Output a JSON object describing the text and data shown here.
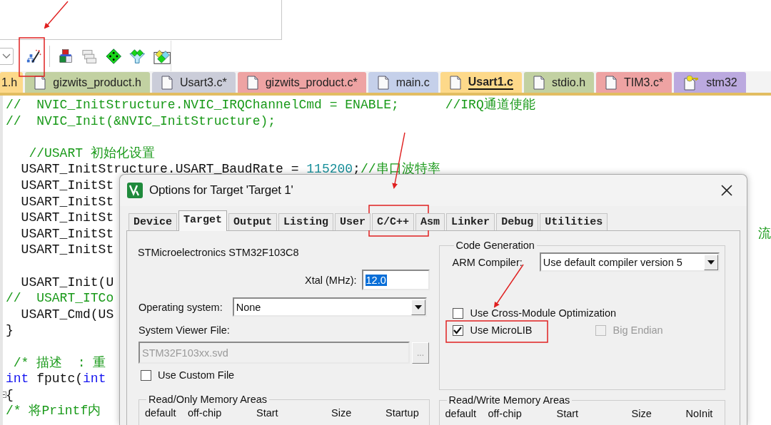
{
  "file_tabs": [
    {
      "label": "1.h",
      "kind": "cut",
      "color": "#fdd98a",
      "selected": false
    },
    {
      "label": "gizwits_product.h",
      "kind": "file",
      "color": "#c2d1a2",
      "selected": false
    },
    {
      "label": "Usart3.c*",
      "kind": "file",
      "color": "#cbcdd9",
      "selected": false
    },
    {
      "label": "gizwits_product.c*",
      "kind": "file",
      "color": "#eea3a3",
      "selected": false
    },
    {
      "label": "main.c",
      "kind": "file",
      "color": "#c5d0ea",
      "selected": false
    },
    {
      "label": "Usart1.c",
      "kind": "file",
      "color": "#fdd98a",
      "selected": true
    },
    {
      "label": "stdio.h",
      "kind": "file",
      "color": "#c2d1a2",
      "selected": false
    },
    {
      "label": "TIM3.c*",
      "kind": "file",
      "color": "#eea3a3",
      "selected": false
    },
    {
      "label": "stm32",
      "kind": "key-file",
      "color": "#bba9df",
      "selected": false
    }
  ],
  "code_lines": [
    {
      "kind": "code",
      "segments": [
        {
          "kind": "comment",
          "text": "//  NVIC_InitStructure.NVIC_IRQChannelCmd = ENABLE;      //IRQ通道使能"
        }
      ]
    },
    {
      "kind": "code",
      "segments": [
        {
          "kind": "comment",
          "text": "//  NVIC_Init(&NVIC_InitStructure);"
        }
      ]
    },
    {
      "kind": "blank"
    },
    {
      "kind": "code",
      "segments": [
        {
          "kind": "comment",
          "text": "   //USART 初始化设置"
        }
      ]
    },
    {
      "kind": "code",
      "segments": [
        {
          "kind": "plain",
          "text": "  USART_InitStructure.USART_BaudRate = "
        },
        {
          "kind": "number",
          "text": "115200"
        },
        {
          "kind": "plain",
          "text": ";"
        },
        {
          "kind": "comment",
          "text": "//串口波特率"
        }
      ]
    },
    {
      "kind": "code",
      "segments": [
        {
          "kind": "plain",
          "text": "  USART_InitSt"
        }
      ]
    },
    {
      "kind": "code",
      "segments": [
        {
          "kind": "plain",
          "text": "  USART_InitSt"
        }
      ]
    },
    {
      "kind": "code",
      "segments": [
        {
          "kind": "plain",
          "text": "  USART_InitSt"
        }
      ]
    },
    {
      "kind": "code",
      "segments": [
        {
          "kind": "plain",
          "text": "  USART_InitSt"
        }
      ],
      "right": "流"
    },
    {
      "kind": "code",
      "segments": [
        {
          "kind": "plain",
          "text": "  USART_InitSt"
        }
      ]
    },
    {
      "kind": "blank"
    },
    {
      "kind": "code",
      "segments": [
        {
          "kind": "plain",
          "text": "  USART_Init(U"
        }
      ]
    },
    {
      "kind": "code",
      "segments": [
        {
          "kind": "comment",
          "text": "//  USART_ITCo"
        }
      ]
    },
    {
      "kind": "code",
      "segments": [
        {
          "kind": "plain",
          "text": "  USART_Cmd(US"
        }
      ]
    },
    {
      "kind": "code",
      "segments": [
        {
          "kind": "plain",
          "text": "}"
        }
      ]
    },
    {
      "kind": "blank"
    },
    {
      "kind": "code",
      "segments": [
        {
          "kind": "comment",
          "text": " /* 描述  : 重"
        }
      ]
    },
    {
      "kind": "code",
      "segments": [
        {
          "kind": "keyword",
          "text": "int"
        },
        {
          "kind": "plain",
          "text": " fputc("
        },
        {
          "kind": "keyword",
          "text": "int"
        }
      ]
    },
    {
      "kind": "code",
      "fold": true,
      "segments": [
        {
          "kind": "plain",
          "text": "{"
        }
      ]
    },
    {
      "kind": "code",
      "segments": [
        {
          "kind": "comment",
          "text": "/* 将Printf内"
        }
      ]
    }
  ],
  "dialog": {
    "title": "Options for Target 'Target 1'",
    "tabs": [
      {
        "label": "Device",
        "selected": false
      },
      {
        "label": "Target",
        "selected": true
      },
      {
        "label": "Output",
        "selected": false
      },
      {
        "label": "Listing",
        "selected": false
      },
      {
        "label": "User",
        "selected": false
      },
      {
        "label": "C/C++",
        "selected": false
      },
      {
        "label": "Asm",
        "selected": false
      },
      {
        "label": "Linker",
        "selected": false
      },
      {
        "label": "Debug",
        "selected": false
      },
      {
        "label": "Utilities",
        "selected": false
      }
    ],
    "device": "STMicroelectronics STM32F103C8",
    "xtal": {
      "label": "Xtal (MHz):",
      "value": "12.0"
    },
    "operating_system": {
      "label": "Operating system:",
      "value": "None"
    },
    "system_viewer": {
      "label": "System Viewer File:",
      "value": "STM32F103xx.svd",
      "browse": "..."
    },
    "custom_file": {
      "label": "Use Custom File",
      "checked": false
    },
    "ro_memory": {
      "title": "Read/Only Memory Areas",
      "columns": [
        "default",
        "off-chip",
        "Start",
        "Size",
        "Startup"
      ]
    },
    "code_generation": {
      "title": "Code Generation",
      "compiler_label": "ARM Compiler:",
      "compiler_value": "Use default compiler version 5",
      "options": [
        {
          "label": "Use Cross-Module Optimization",
          "checked": false,
          "disabled": false
        },
        {
          "label": "Use MicroLIB",
          "checked": true,
          "disabled": false
        },
        {
          "label": "Big Endian",
          "checked": false,
          "disabled": true
        }
      ]
    },
    "rw_memory": {
      "title": "Read/Write Memory Areas",
      "columns": [
        "default",
        "off-chip",
        "Start",
        "Size",
        "NoInit"
      ]
    }
  }
}
